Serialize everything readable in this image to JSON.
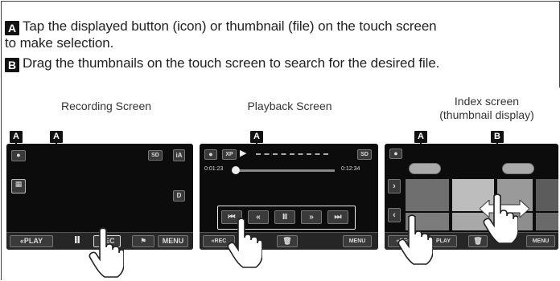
{
  "instructions": {
    "a_badge": "A",
    "a_line1": "Tap the displayed button (icon) or thumbnail (file) on the touch screen",
    "a_line2": "to make selection.",
    "b_badge": "B",
    "b_line": "Drag the thumbnails on the touch screen to search for the desired file."
  },
  "captions": {
    "recording": "Recording Screen",
    "playback": "Playback Screen",
    "index_line1": "Index screen",
    "index_line2": "(thumbnail display)"
  },
  "labels": {
    "a": "A",
    "b": "B"
  },
  "recording_screen": {
    "play_button": "«PLAY",
    "pause_symbol": "Ⅱ",
    "rec_button": "REC",
    "menu_button": "MENU",
    "sd_badge": "SD",
    "d_badge": "D"
  },
  "playback_screen": {
    "time_start": "0:01:23",
    "time_end": "0:12:34",
    "xp_badge": "XP",
    "sd_badge": "SD",
    "rec_button": "«REC",
    "menu_button": "MENU",
    "controls": [
      "⏮",
      "«",
      "Ⅱ",
      "»",
      "⏭"
    ]
  },
  "index_screen": {
    "rec_button": "«REC",
    "play_button": "PLAY",
    "menu_button": "MENU"
  },
  "colors": {
    "screen": "#0c0c0c",
    "badge": "#111111",
    "text": "#222222"
  }
}
